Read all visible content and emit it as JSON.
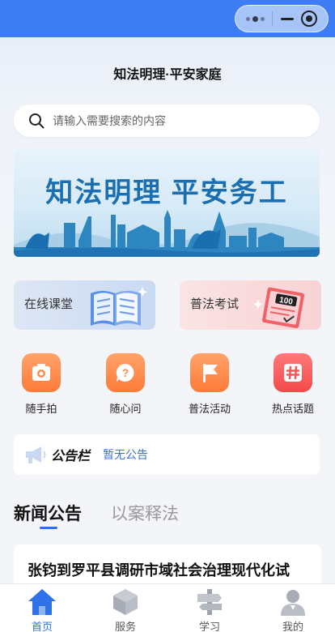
{
  "header": {
    "title": "知法明理·平安家庭"
  },
  "search": {
    "placeholder": "请输入需要搜索的内容"
  },
  "banner": {
    "text": "知法明理  平安务工"
  },
  "promos": [
    {
      "label": "在线课堂",
      "icon": "book-icon"
    },
    {
      "label": "普法考试",
      "icon": "exam-paper-icon"
    }
  ],
  "quick_actions": [
    {
      "label": "随手拍",
      "icon": "camera-icon",
      "color": "#ff8b4a"
    },
    {
      "label": "随心问",
      "icon": "question-icon",
      "color": "#ff8b4a"
    },
    {
      "label": "普法活动",
      "icon": "flag-icon",
      "color": "#ff8b4a"
    },
    {
      "label": "热点话题",
      "icon": "hashtag-icon",
      "color": "#f55656"
    }
  ],
  "notice": {
    "tag": "公告栏",
    "text": "暂无公告"
  },
  "tabs": [
    {
      "label": "新闻公告",
      "active": true
    },
    {
      "label": "以案释法",
      "active": false
    }
  ],
  "news": [
    {
      "title": "张钧到罗平县调研市域社会治理现代化试"
    }
  ],
  "tabbar": [
    {
      "label": "首页",
      "icon": "home-icon",
      "active": true
    },
    {
      "label": "服务",
      "icon": "cube-icon",
      "active": false
    },
    {
      "label": "学习",
      "icon": "signpost-icon",
      "active": false
    },
    {
      "label": "我的",
      "icon": "user-icon",
      "active": false
    }
  ],
  "colors": {
    "top_bar": "#3d7cf2",
    "accent": "#2f72e8",
    "orange": "#ff8b4a",
    "red": "#f55656"
  }
}
